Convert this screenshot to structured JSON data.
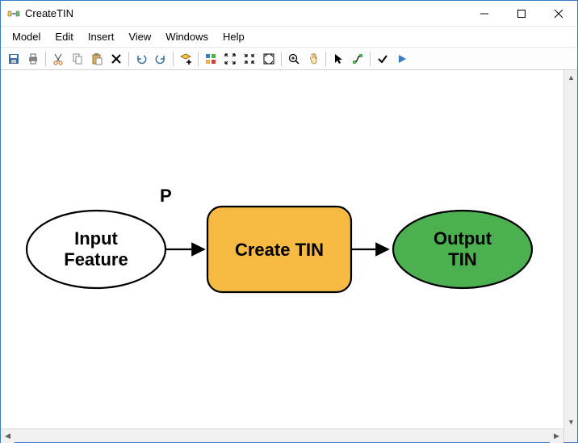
{
  "window": {
    "title": "CreateTIN"
  },
  "menu": {
    "items": [
      "Model",
      "Edit",
      "Insert",
      "View",
      "Windows",
      "Help"
    ]
  },
  "toolbar": {
    "icons": [
      "save-icon",
      "print-icon",
      "sep",
      "cut-icon",
      "copy-icon",
      "paste-icon",
      "delete-icon",
      "sep",
      "undo-icon",
      "redo-icon",
      "sep",
      "add-data-icon",
      "sep",
      "full-extent-icon",
      "fixed-zoom-in-icon",
      "fixed-zoom-out-icon",
      "auto-layout-icon",
      "sep",
      "zoom-in-icon",
      "pan-icon",
      "sep",
      "select-icon",
      "connect-icon",
      "sep",
      "validate-icon",
      "run-icon"
    ]
  },
  "diagram": {
    "parameter_label": "P",
    "input_node": {
      "line1": "Input",
      "line2": "Feature"
    },
    "process_node": {
      "label": "Create TIN"
    },
    "output_node": {
      "line1": "Output",
      "line2": "TIN"
    },
    "colors": {
      "process_fill": "#f6b941",
      "output_fill": "#4cb050",
      "stroke": "#000000"
    }
  }
}
